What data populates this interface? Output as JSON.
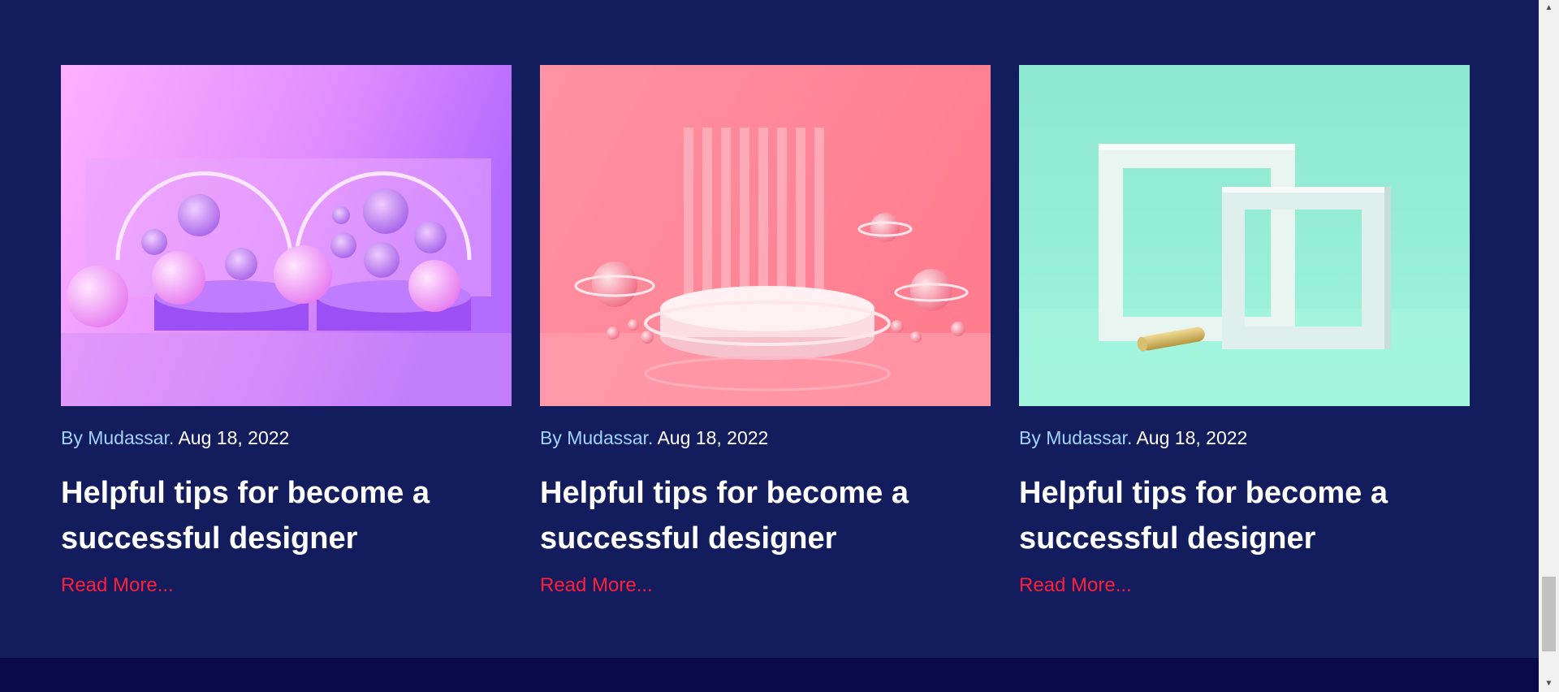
{
  "posts": [
    {
      "image": "purple-spheres-glass-image",
      "by_label": "By",
      "author": "Mudassar.",
      "date": "Aug 18, 2022",
      "title": "Helpful tips for become a successful designer",
      "read_more": "Read More..."
    },
    {
      "image": "pink-podium-planets-image",
      "by_label": "By",
      "author": "Mudassar.",
      "date": "Aug 18, 2022",
      "title": "Helpful tips for become a successful designer",
      "read_more": "Read More..."
    },
    {
      "image": "mint-frames-image",
      "by_label": "By",
      "author": "Mudassar.",
      "date": "Aug 18, 2022",
      "title": "Helpful tips for become a successful designer",
      "read_more": "Read More..."
    }
  ],
  "colors": {
    "background": "#131c5c",
    "footer": "#0a0a4a",
    "meta_accent": "#9fd3f7",
    "read_more": "#ff1f3d"
  },
  "scrollbar": {
    "up_icon": "scroll-up-arrow-icon",
    "down_icon": "scroll-down-arrow-icon"
  }
}
